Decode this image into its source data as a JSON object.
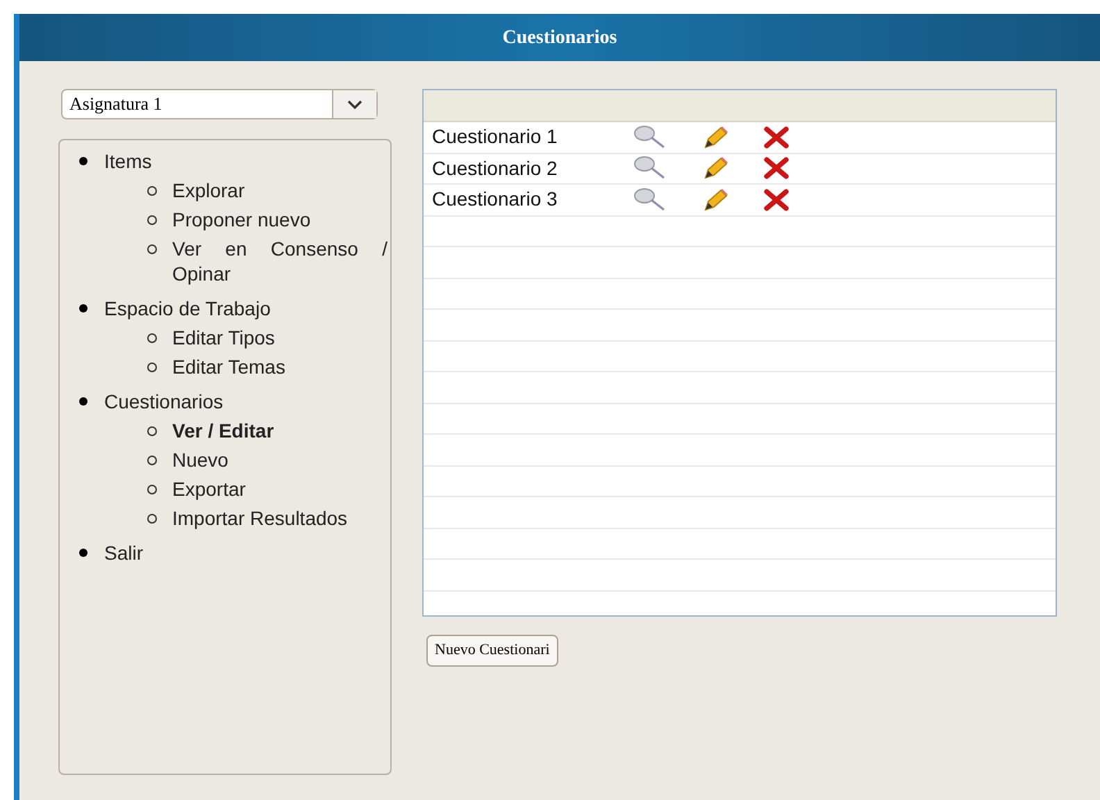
{
  "window": {
    "title": "Cuestionarios"
  },
  "subject_select": {
    "value": "Asignatura 1"
  },
  "menu": [
    {
      "label": "Items",
      "children": [
        {
          "label": "Explorar",
          "selected": false
        },
        {
          "label": "Proponer nuevo",
          "selected": false
        },
        {
          "label": "Ver en Consenso / Opinar",
          "selected": false
        }
      ]
    },
    {
      "label": "Espacio de Trabajo",
      "children": [
        {
          "label": "Editar Tipos",
          "selected": false
        },
        {
          "label": "Editar Temas",
          "selected": false
        }
      ]
    },
    {
      "label": "Cuestionarios",
      "children": [
        {
          "label": "Ver / Editar",
          "selected": true
        },
        {
          "label": "Nuevo",
          "selected": false
        },
        {
          "label": "Exportar",
          "selected": false
        },
        {
          "label": "Importar Resultados",
          "selected": false
        }
      ]
    },
    {
      "label": "Salir"
    }
  ],
  "table": {
    "rows": [
      {
        "name": "Cuestionario 1"
      },
      {
        "name": "Cuestionario 2"
      },
      {
        "name": "Cuestionario 3"
      }
    ]
  },
  "new_button": {
    "label": "Nuevo Cuestionari"
  }
}
